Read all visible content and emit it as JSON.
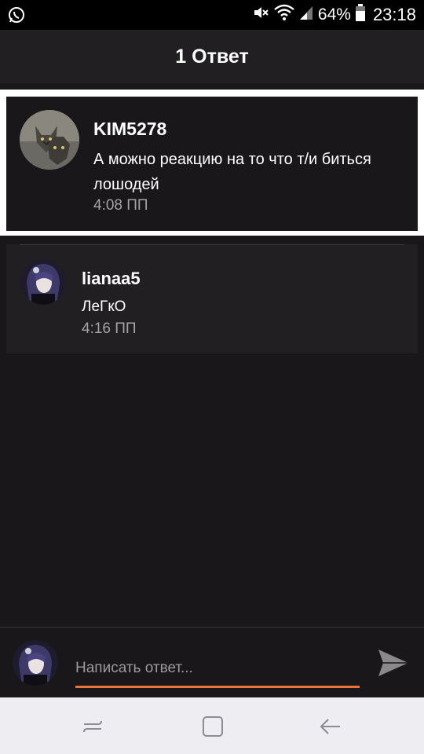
{
  "status_bar": {
    "battery_percent": "64%",
    "time": "23:18",
    "icons": [
      "whatsapp-icon",
      "mute-icon",
      "wifi-icon",
      "signal-icon",
      "battery-icon"
    ]
  },
  "header": {
    "title": "1 Ответ"
  },
  "post": {
    "username": "KIM5278",
    "text": "А можно реакцию на то что т/и биться лошодей",
    "time": "4:08 ПП",
    "avatar": "wolf-avatar"
  },
  "replies": [
    {
      "username": "lianaa5",
      "text": "ЛеГкО",
      "time": "4:16 ПП",
      "avatar": "anime-avatar"
    }
  ],
  "composer": {
    "placeholder": "Написать ответ...",
    "send_icon": "send-icon"
  },
  "nav_bar": {
    "icons": [
      "recent-apps-icon",
      "home-icon",
      "back-icon"
    ]
  },
  "colors": {
    "accent": "#e8743a",
    "background": "#19171a",
    "card": "#211f22"
  }
}
